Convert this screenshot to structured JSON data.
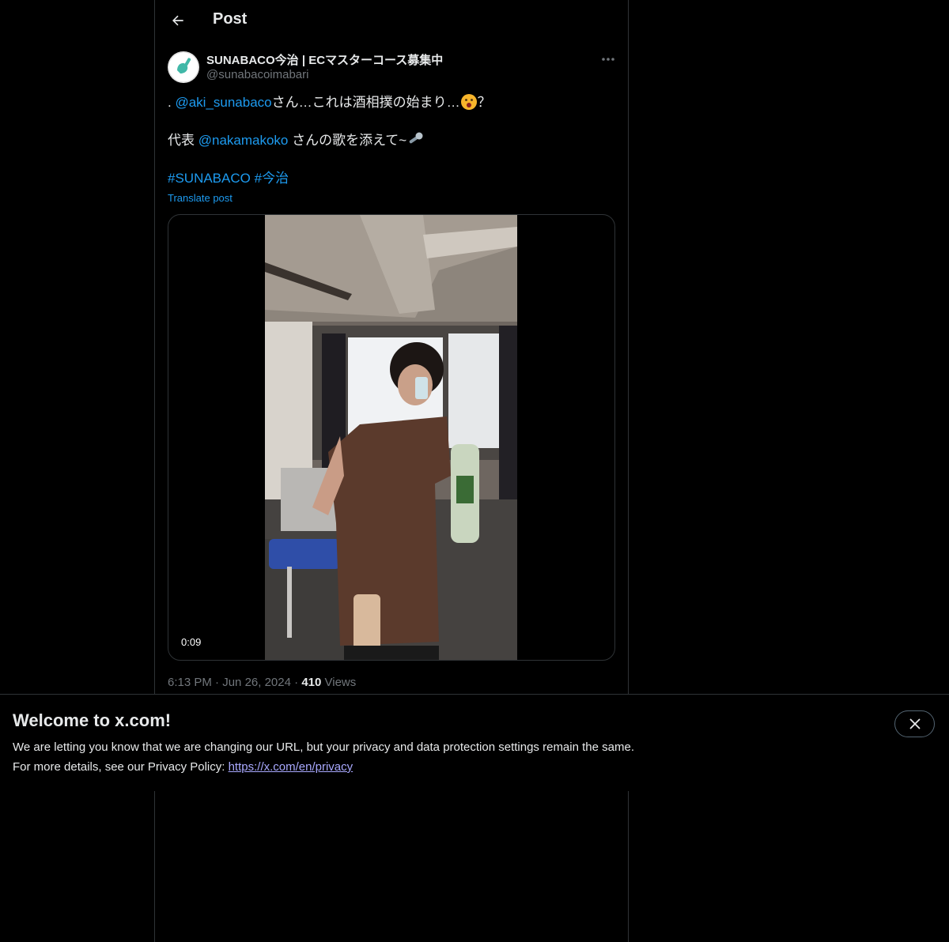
{
  "header": {
    "title": "Post"
  },
  "author": {
    "name": "SUNABACO今治 | ECマスターコース募集中",
    "handle": "@sunabacoimabari"
  },
  "tweet": {
    "line1_prefix": ". ",
    "mention1": "@aki_sunabaco",
    "line1_suffix": "さん…これは酒相撲の始まり…",
    "line1_end": "？",
    "line2_prefix": "代表 ",
    "mention2": "@nakamakoko",
    "line2_suffix": " さんの歌を添えて~",
    "hashtag1": "#SUNABACO",
    "hashtag2": "#今治",
    "translate_label": "Translate post"
  },
  "media": {
    "duration": "0:09"
  },
  "meta": {
    "time": "6:13 PM",
    "separator": "·",
    "date": "Jun 26, 2024",
    "views_count": "410",
    "views_label": "Views"
  },
  "banner": {
    "title": "Welcome to x.com!",
    "line1": "We are letting you know that we are changing our URL, but your privacy and data protection settings remain the same.",
    "line2_prefix": "For more details, see our Privacy Policy: ",
    "link": "https://x.com/en/privacy"
  },
  "colors": {
    "accent": "#1d9bf0",
    "background": "#000000",
    "text": "#e7e9ea",
    "muted": "#71767b",
    "border": "#2f3336"
  },
  "icons": {
    "back": "arrow-left-icon",
    "more": "ellipsis-icon",
    "close": "close-icon",
    "avatar": "shovel-logo-icon"
  }
}
